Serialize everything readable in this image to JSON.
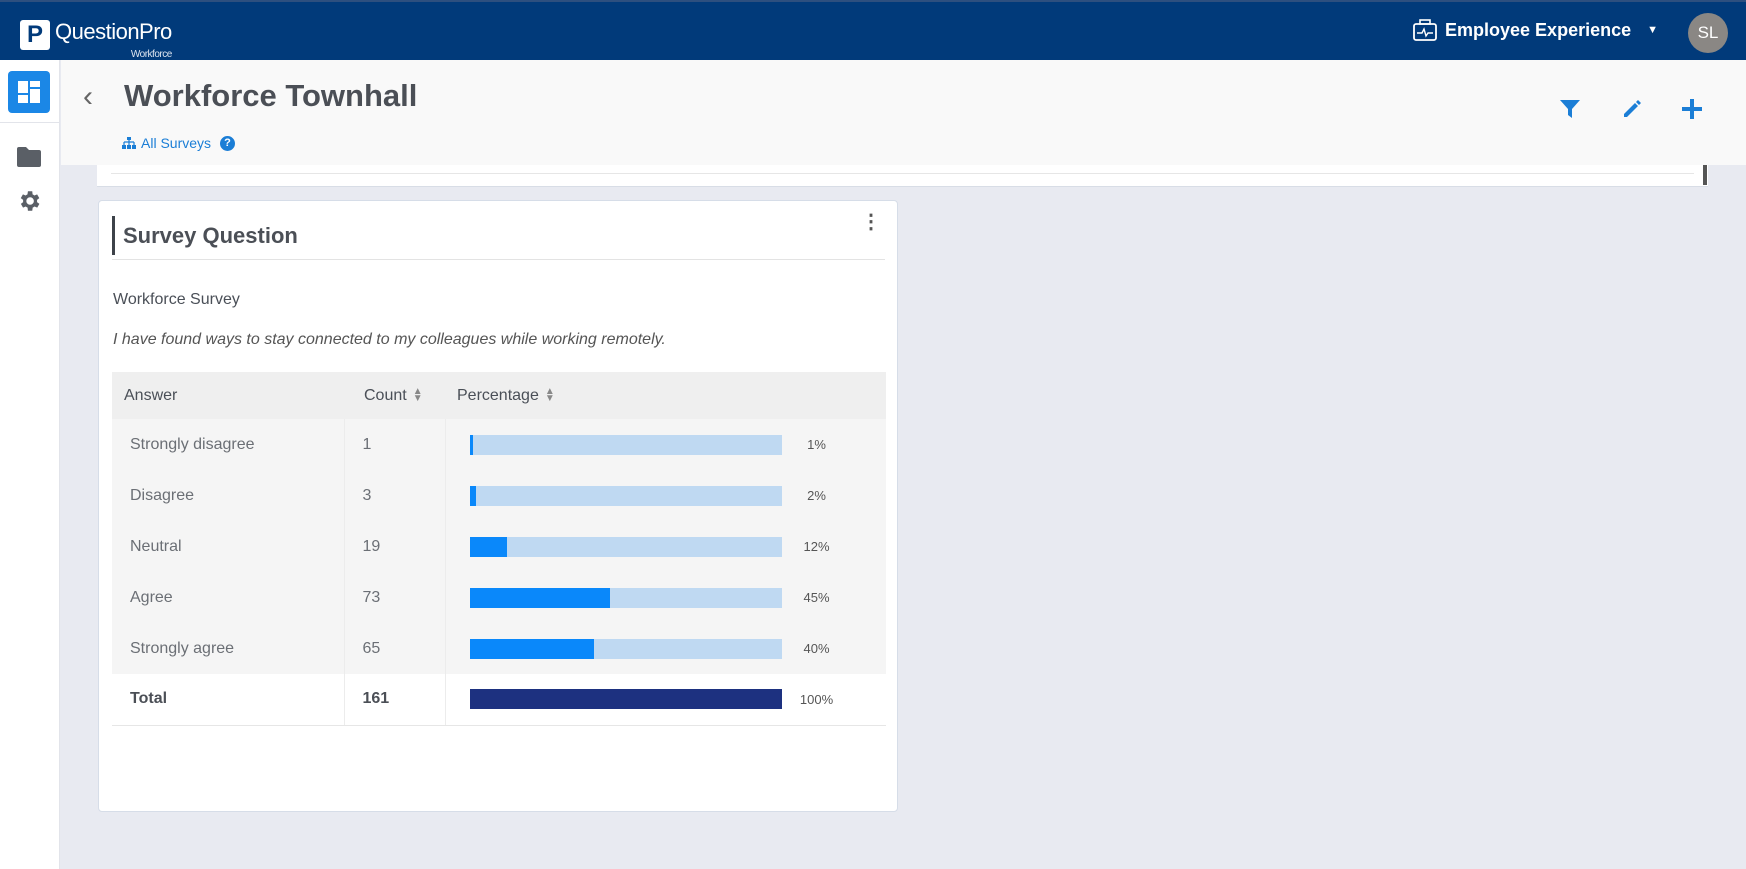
{
  "header": {
    "logo_text": "QuestionPro",
    "logo_sub": "Workforce",
    "logo_letter": "P",
    "product": "Employee Experience",
    "avatar_initials": "SL"
  },
  "titlebar": {
    "title": "Workforce Townhall",
    "breadcrumb": "All Surveys",
    "help": "?"
  },
  "card": {
    "title": "Survey Question",
    "survey_name": "Workforce Survey",
    "question": "I have found ways to stay connected to my colleagues while working remotely.",
    "columns": {
      "answer": "Answer",
      "count": "Count",
      "percentage": "Percentage"
    },
    "rows": [
      {
        "answer": "Strongly disagree",
        "count": "1",
        "percent_label": "1%",
        "percent": 1
      },
      {
        "answer": "Disagree",
        "count": "3",
        "percent_label": "2%",
        "percent": 2
      },
      {
        "answer": "Neutral",
        "count": "19",
        "percent_label": "12%",
        "percent": 12
      },
      {
        "answer": "Agree",
        "count": "73",
        "percent_label": "45%",
        "percent": 45
      },
      {
        "answer": "Strongly agree",
        "count": "65",
        "percent_label": "40%",
        "percent": 40
      }
    ],
    "total": {
      "answer": "Total",
      "count": "161",
      "percent_label": "100%",
      "percent": 100
    }
  },
  "colors": {
    "header": "#013a7a",
    "accent": "#1b87e6",
    "bar_fill": "#0a88fa",
    "bar_track": "#bfd9f2",
    "total_bar": "#1d3180"
  }
}
